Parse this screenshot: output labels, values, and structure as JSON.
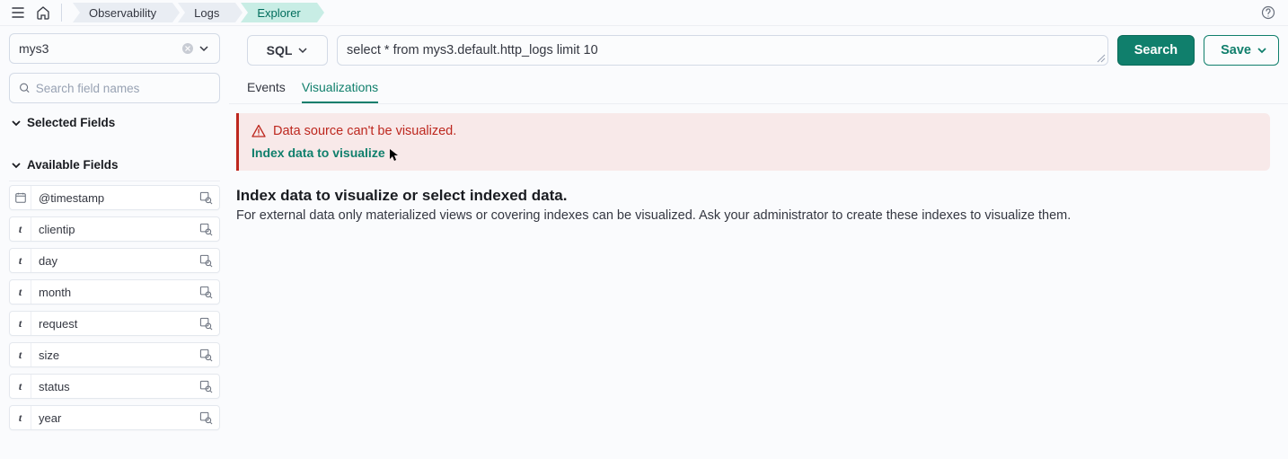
{
  "breadcrumbs": {
    "items": [
      "Observability",
      "Logs",
      "Explorer"
    ]
  },
  "sidebar": {
    "datasource": "mys3",
    "search_placeholder": "Search field names",
    "sections": {
      "selected": "Selected Fields",
      "available": "Available Fields"
    },
    "fields": [
      {
        "type": "date",
        "name": "@timestamp"
      },
      {
        "type": "text",
        "name": "clientip"
      },
      {
        "type": "text",
        "name": "day"
      },
      {
        "type": "text",
        "name": "month"
      },
      {
        "type": "text",
        "name": "request"
      },
      {
        "type": "text",
        "name": "size"
      },
      {
        "type": "text",
        "name": "status"
      },
      {
        "type": "text",
        "name": "year"
      }
    ]
  },
  "query": {
    "lang": "SQL",
    "text": "select * from mys3.default.http_logs limit 10",
    "search_btn": "Search",
    "save_btn": "Save"
  },
  "tabs": {
    "events": "Events",
    "visualizations": "Visualizations"
  },
  "callout": {
    "title": "Data source can't be visualized.",
    "link": "Index data to visualize"
  },
  "message": {
    "title": "Index data to visualize or select indexed data.",
    "body": "For external data only materialized views or covering indexes can be visualized. Ask your administrator to create these indexes to visualize them."
  }
}
